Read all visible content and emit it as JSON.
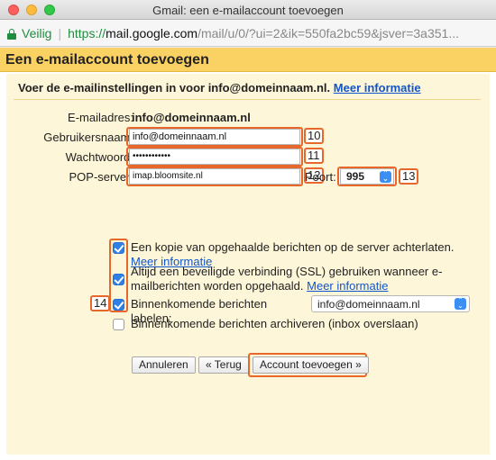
{
  "window": {
    "title": "Gmail: een e-mailaccount toevoegen"
  },
  "urlbar": {
    "secure_label": "Veilig",
    "scheme": "https://",
    "host": "mail.google.com",
    "path": "/mail/u/0/?ui=2&ik=550fa2bc59&jsver=3a351..."
  },
  "page": {
    "title": "Een e-mailaccount toevoegen",
    "intro": "Voer de e-mailinstellingen in voor info@domeinnaam.nl.",
    "intro_link": "Meer informatie"
  },
  "form": {
    "email_label": "E-mailadres:",
    "email_value": "info@domeinnaam.nl",
    "username_label": "Gebruikersnaam:",
    "username_value": "info@domeinnaam.nl",
    "password_label": "Wachtwoord:",
    "password_value": "••••••••••••",
    "pop_label": "POP-server:",
    "pop_value": "imap.bloomsite.nl",
    "port_label": "Poort:",
    "port_value": "995"
  },
  "badges": {
    "b10": "10",
    "b11": "11",
    "b12": "12",
    "b13": "13",
    "b14": "14"
  },
  "options": [
    {
      "text": "Een kopie van opgehaalde berichten op de server achterlaten.",
      "link": "Meer informatie",
      "checked": true
    },
    {
      "text": "Altijd een beveiligde verbinding (SSL) gebruiken wanneer e-mailberichten worden opgehaald.",
      "link": "Meer informatie",
      "checked": true
    },
    {
      "text": "Binnenkomende berichten labelen:",
      "select_value": "info@domeinnaam.nl",
      "checked": true
    },
    {
      "text": "Binnenkomende berichten archiveren (inbox overslaan)",
      "checked": false
    }
  ],
  "buttons": {
    "cancel": "Annuleren",
    "back": "« Terug",
    "add": "Account toevoegen »"
  },
  "colors": {
    "header_bg": "#fad163",
    "panel_bg": "#fef6d8",
    "highlight": "#e8672a",
    "link": "#1155cc"
  }
}
